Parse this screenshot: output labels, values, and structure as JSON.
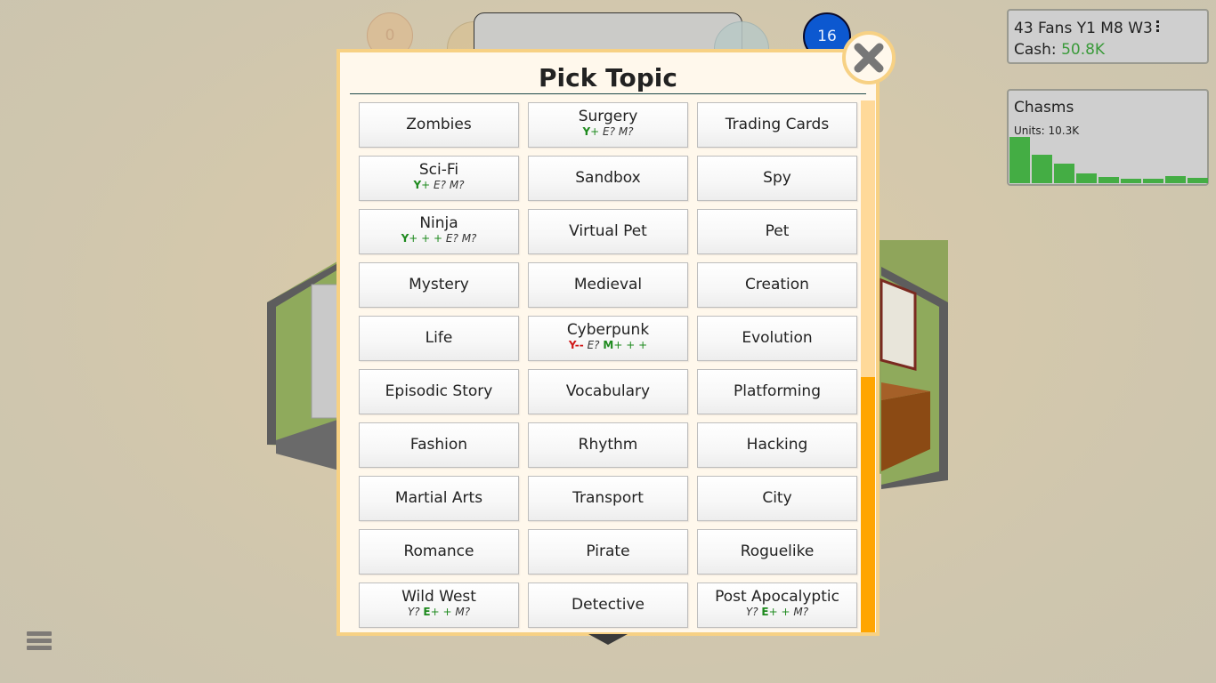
{
  "hud": {
    "research_points": "0",
    "fans_bubble": "16"
  },
  "status": {
    "fans_line": "43 Fans Y1 M8 W3",
    "cash_label": "Cash: ",
    "cash_value": "50.8K",
    "cash_color": "#3a9a3a"
  },
  "sales": {
    "game_title": "Chasms",
    "units_label": "Units: 10.3K",
    "bar_color": "#44ad44",
    "weekly_units_relative": [
      1.0,
      0.62,
      0.42,
      0.22,
      0.14,
      0.1,
      0.09,
      0.15,
      0.12
    ]
  },
  "dialog": {
    "title": "Pick Topic",
    "close_label": "close",
    "scroll_position": {
      "thumb_start_fraction": 0.52,
      "thumb_end_fraction": 1.0
    },
    "topics": [
      {
        "name": "Zombies"
      },
      {
        "name": "Surgery",
        "ratings": [
          {
            "t": "Y+",
            "k": "good"
          },
          {
            "t": "E?",
            "k": "unk"
          },
          {
            "t": "M?",
            "k": "unk"
          }
        ]
      },
      {
        "name": "Trading Cards"
      },
      {
        "name": "Sci-Fi",
        "ratings": [
          {
            "t": "Y+",
            "k": "good"
          },
          {
            "t": "E?",
            "k": "unk"
          },
          {
            "t": "M?",
            "k": "unk"
          }
        ]
      },
      {
        "name": "Sandbox"
      },
      {
        "name": "Spy"
      },
      {
        "name": "Ninja",
        "ratings": [
          {
            "t": "Y+++",
            "k": "good"
          },
          {
            "t": "E?",
            "k": "unk"
          },
          {
            "t": "M?",
            "k": "unk"
          }
        ]
      },
      {
        "name": "Virtual Pet"
      },
      {
        "name": "Pet"
      },
      {
        "name": "Mystery"
      },
      {
        "name": "Medieval"
      },
      {
        "name": "Creation"
      },
      {
        "name": "Life"
      },
      {
        "name": "Cyberpunk",
        "ratings": [
          {
            "t": "Y--",
            "k": "bad"
          },
          {
            "t": "E?",
            "k": "unk"
          },
          {
            "t": "M+++",
            "k": "good"
          }
        ]
      },
      {
        "name": "Evolution"
      },
      {
        "name": "Episodic Story"
      },
      {
        "name": "Vocabulary"
      },
      {
        "name": "Platforming"
      },
      {
        "name": "Fashion"
      },
      {
        "name": "Rhythm"
      },
      {
        "name": "Hacking"
      },
      {
        "name": "Martial Arts"
      },
      {
        "name": "Transport"
      },
      {
        "name": "City"
      },
      {
        "name": "Romance"
      },
      {
        "name": "Pirate"
      },
      {
        "name": "Roguelike"
      },
      {
        "name": "Wild West",
        "ratings": [
          {
            "t": "Y?",
            "k": "unk"
          },
          {
            "t": "E++",
            "k": "good"
          },
          {
            "t": "M?",
            "k": "unk"
          }
        ]
      },
      {
        "name": "Detective"
      },
      {
        "name": "Post Apocalyptic",
        "ratings": [
          {
            "t": "Y?",
            "k": "unk"
          },
          {
            "t": "E++",
            "k": "good"
          },
          {
            "t": "M?",
            "k": "unk"
          }
        ]
      }
    ]
  },
  "icons": {
    "menu": "hamburger-menu-icon",
    "close": "close-x-icon",
    "more": "vertical-ellipsis-icon"
  }
}
